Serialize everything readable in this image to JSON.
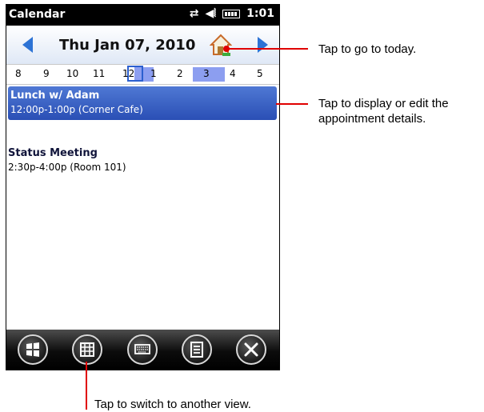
{
  "statusbar": {
    "title": "Calendar",
    "time": "1:01"
  },
  "header": {
    "date": "Thu  Jan 07, 2010"
  },
  "day_strip": [
    "8",
    "9",
    "10",
    "11",
    "12",
    "1",
    "2",
    "3",
    "4",
    "5"
  ],
  "appointments": [
    {
      "title": "Lunch w/ Adam",
      "detail": "12:00p-1:00p (Corner Cafe)"
    },
    {
      "title": "Status Meeting",
      "detail": "2:30p-4:00p (Room 101)"
    }
  ],
  "toolbar": {
    "icons": [
      "windows-start-icon",
      "calendar-grid-icon",
      "keyboard-icon",
      "menu-list-icon",
      "close-icon"
    ]
  },
  "callouts": {
    "today": "Tap to go to today.",
    "details": "Tap to display or edit the appointment details.",
    "view": "Tap to switch to another view."
  },
  "colors": {
    "accent": "#2d73d5",
    "selection": "#3d62c8",
    "callout": "#e00000"
  }
}
